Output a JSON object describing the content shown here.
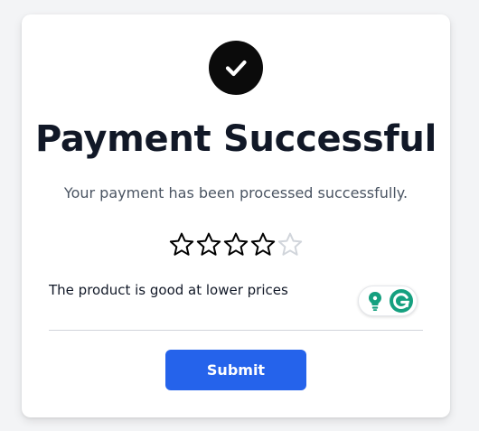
{
  "title": "Payment Successful",
  "subtitle": "Your payment has been processed successfully.",
  "rating": {
    "value": 4,
    "max": 5,
    "filled_color": "#000000",
    "empty_color": "#d1d5db"
  },
  "review": {
    "value": "The product is good at lower prices"
  },
  "submit_label": "Submit",
  "colors": {
    "accent": "#2563eb",
    "check_bg": "#0b0b0b",
    "grammarly": "#15a07f"
  },
  "icons": {
    "success": "check-circle-icon",
    "grammarly_assist": "lightbulb-icon",
    "grammarly": "grammarly-g-icon"
  }
}
